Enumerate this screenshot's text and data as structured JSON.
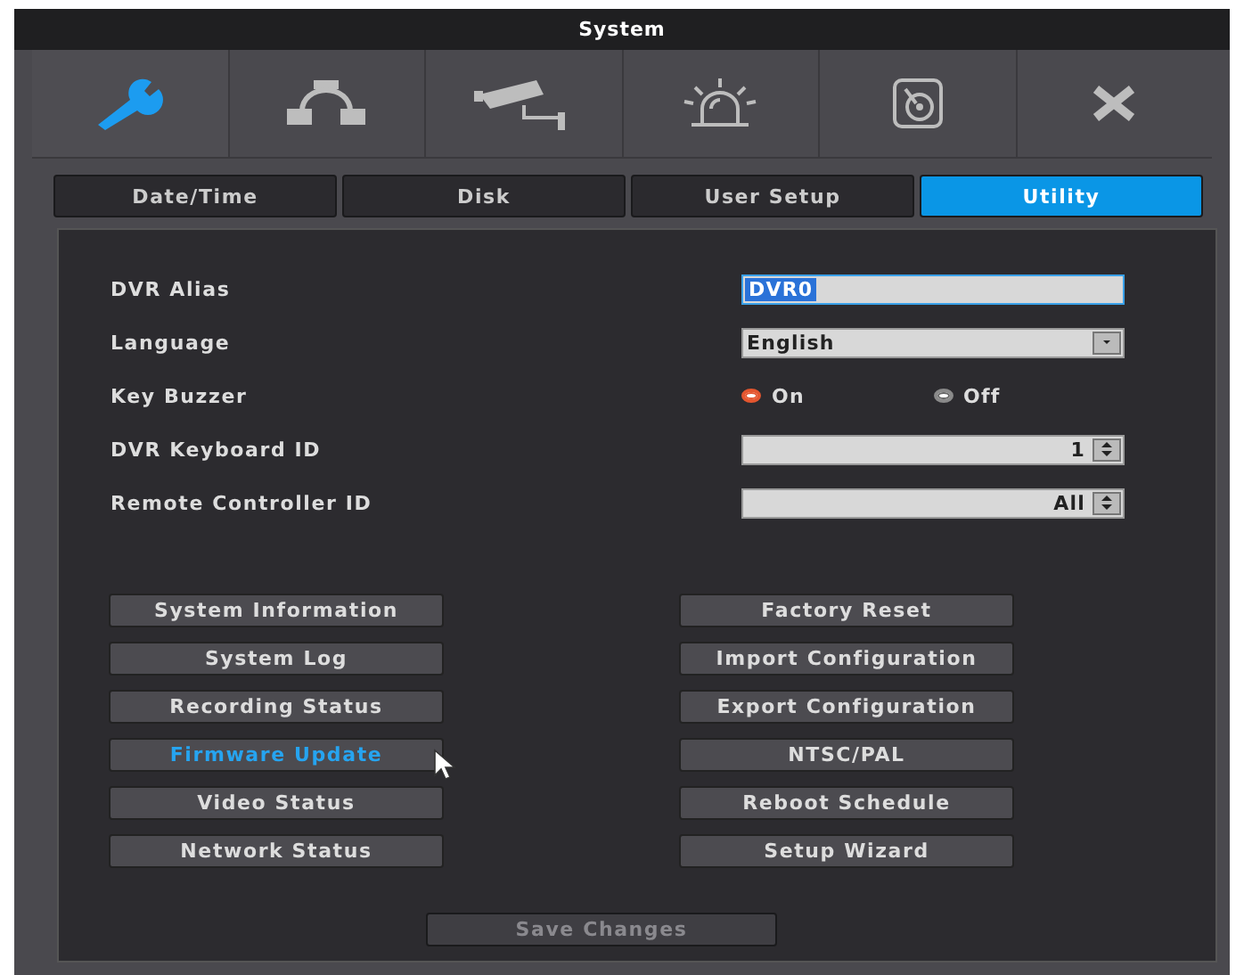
{
  "window": {
    "title": "System"
  },
  "toolbar": [
    {
      "kind": "wrench",
      "selected": true
    },
    {
      "kind": "network",
      "selected": false
    },
    {
      "kind": "camera",
      "selected": false
    },
    {
      "kind": "alarm",
      "selected": false
    },
    {
      "kind": "disk",
      "selected": false
    },
    {
      "kind": "close",
      "selected": false
    }
  ],
  "tabs": [
    {
      "label": "Date/Time",
      "selected": false
    },
    {
      "label": "Disk",
      "selected": false
    },
    {
      "label": "User Setup",
      "selected": false
    },
    {
      "label": "Utility",
      "selected": true
    }
  ],
  "settings": [
    {
      "kind": "text",
      "label": "DVR Alias",
      "value": "DVR0",
      "focused": true
    },
    {
      "kind": "dropdown",
      "label": "Language",
      "value": "English"
    },
    {
      "kind": "radio",
      "label": "Key Buzzer",
      "options": [
        {
          "label": "On",
          "selected": true
        },
        {
          "label": "Off",
          "selected": false
        }
      ]
    },
    {
      "kind": "spinner",
      "label": "DVR Keyboard ID",
      "value": "1"
    },
    {
      "kind": "spinner",
      "label": "Remote Controller ID",
      "value": "All"
    }
  ],
  "buttons_left": [
    {
      "label": "System Information",
      "hovered": false
    },
    {
      "label": "System Log",
      "hovered": false
    },
    {
      "label": "Recording Status",
      "hovered": false
    },
    {
      "label": "Firmware Update",
      "hovered": true
    },
    {
      "label": "Video Status",
      "hovered": false
    },
    {
      "label": "Network Status",
      "hovered": false
    }
  ],
  "buttons_right": [
    {
      "label": "Factory Reset",
      "hovered": false
    },
    {
      "label": "Import Configuration",
      "hovered": false
    },
    {
      "label": "Export Configuration",
      "hovered": false
    },
    {
      "label": "NTSC/PAL",
      "hovered": false
    },
    {
      "label": "Reboot Schedule",
      "hovered": false
    },
    {
      "label": "Setup Wizard",
      "hovered": false
    }
  ],
  "save_button": {
    "label": "Save Changes",
    "disabled": true
  }
}
